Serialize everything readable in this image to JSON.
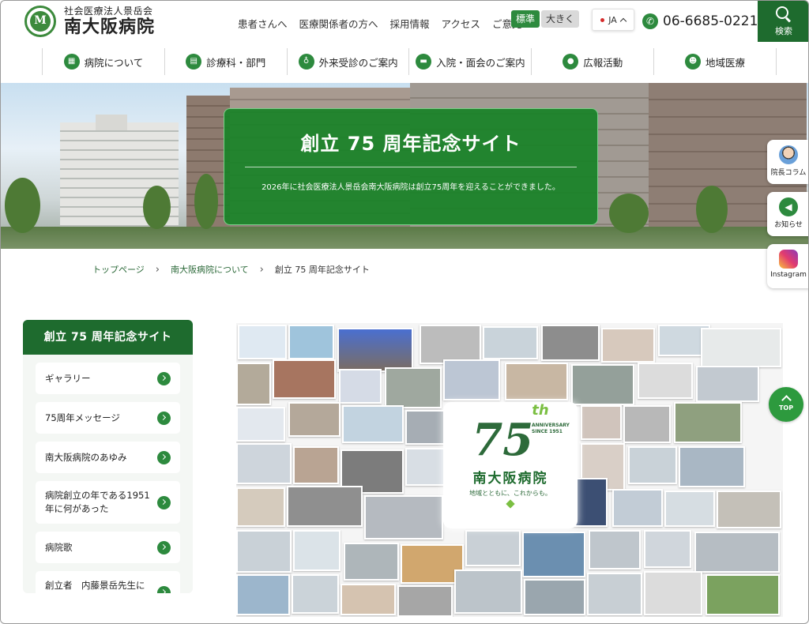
{
  "header": {
    "logo_sub": "社会医療法人景岳会",
    "logo_main": "南大阪病院",
    "logo_mark": "M",
    "nav": [
      "患者さんへ",
      "医療関係者の方へ",
      "採用情報",
      "アクセス",
      "ご意見"
    ],
    "size_standard": "標準",
    "size_large": "大きく",
    "lang": "JA",
    "phone": "06-6685-0221",
    "search_label": "検索"
  },
  "main_nav": [
    {
      "label": "病院について",
      "icon": "hospital-icon"
    },
    {
      "label": "診療科・部門",
      "icon": "clipboard-icon"
    },
    {
      "label": "外来受診のご案内",
      "icon": "stethoscope-icon"
    },
    {
      "label": "入院・面会のご案内",
      "icon": "bed-icon"
    },
    {
      "label": "広報活動",
      "icon": "chat-icon"
    },
    {
      "label": "地域医療",
      "icon": "community-icon"
    }
  ],
  "hero": {
    "title": "創立 75 周年記念サイト",
    "description": "2026年に社会医療法人景岳会南大阪病院は創立75周年を迎えることができました。"
  },
  "breadcrumb": {
    "items": [
      "トップページ",
      "南大阪病院について"
    ],
    "current": "創立 75 周年記念サイト"
  },
  "side_widgets": [
    {
      "label": "院長コラム",
      "icon": "doctor-avatar-icon"
    },
    {
      "label": "お知らせ",
      "icon": "megaphone-icon"
    },
    {
      "label": "Instagram",
      "icon": "instagram-icon"
    }
  ],
  "sidebar": {
    "title": "創立 75 周年記念サイト",
    "items": [
      "ギャラリー",
      "75周年メッセージ",
      "南大阪病院のあゆみ",
      "病院創立の年である1951年に何があった",
      "病院歌",
      "創立者　内藤景岳先生について"
    ]
  },
  "collage_logo": {
    "number": "75",
    "suffix": "th",
    "anniversary": "ANNIVERSARY",
    "since": "SINCE 1951",
    "name": "南大阪病院",
    "tagline": "地域とともに、これからも。"
  },
  "top_button": "TOP",
  "colors": {
    "primary_green": "#1e6b2e",
    "accent_green": "#2d8a3e",
    "light_green": "#7bbf42"
  }
}
